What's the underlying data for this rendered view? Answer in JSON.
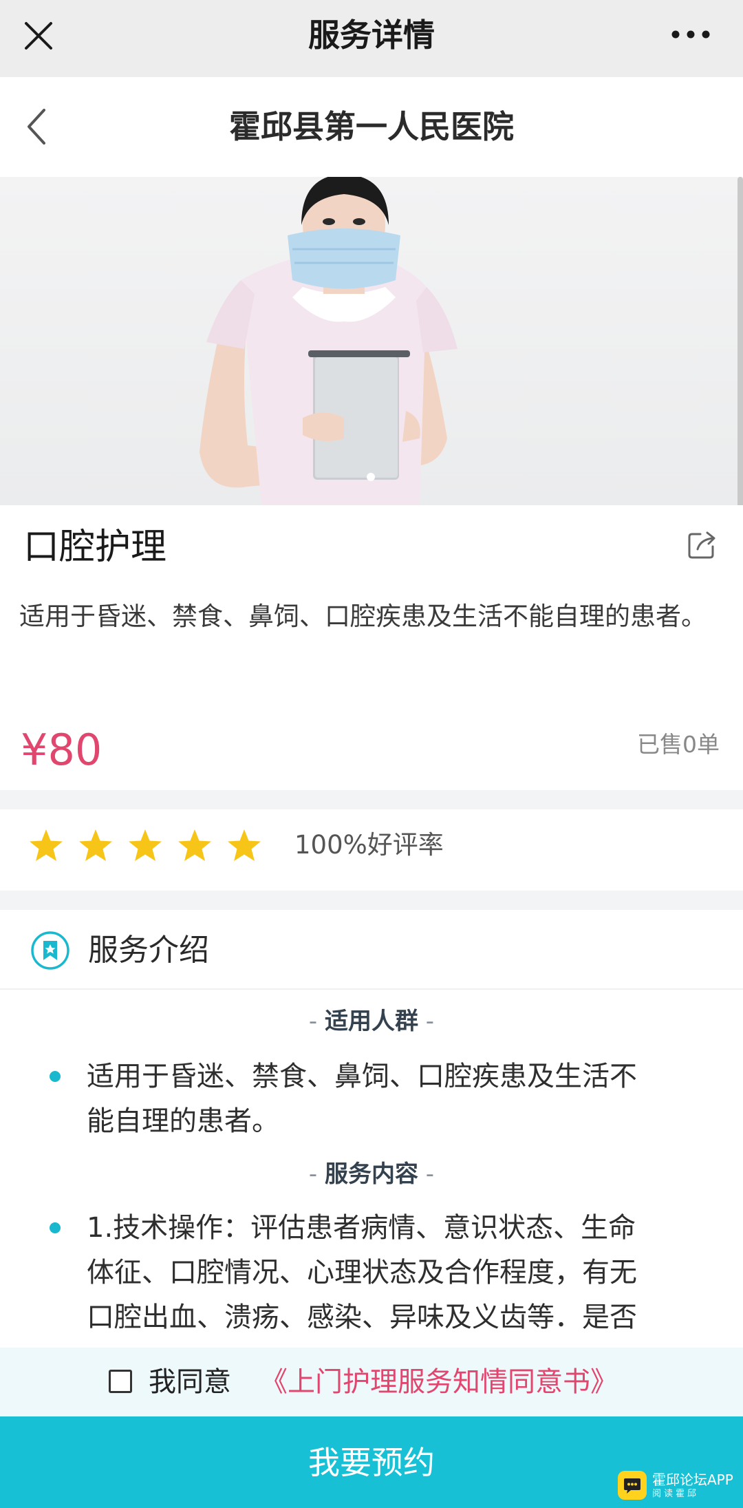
{
  "topbar": {
    "title": "服务详情",
    "close_icon": "close-icon",
    "more_icon": "more-dots-icon"
  },
  "navbar": {
    "title": "霍邱县第一人民医院",
    "back_icon": "chevron-left-icon"
  },
  "hero": {
    "image": "nurse-with-mask-holding-clipboard-photo"
  },
  "service": {
    "title": "口腔护理",
    "description": "适用于昏迷、禁食、鼻饲、口腔疾患及生活不能自理的患者。",
    "price": "¥80",
    "sold": "已售0单"
  },
  "rating": {
    "stars": 5,
    "max_stars": 5,
    "rate_text": "100%好评率",
    "star_color": "#f7c518"
  },
  "intro": {
    "title": "服务介绍",
    "sections": [
      {
        "heading": "适用人群",
        "lines": [
          "适用于昏迷、禁食、鼻饲、口腔疾患及生活不",
          "能自理的患者。"
        ]
      },
      {
        "heading": "服务内容",
        "lines": [
          "1.技术操作：评估患者病情、意识状态、生命",
          "体征、口腔情况、心理状态及合作程度，有无",
          "口腔出血、溃疡、感染、异味及义齿等．是否"
        ]
      }
    ]
  },
  "agreement": {
    "prefix": "我同意",
    "link": "《上门护理服务知情同意书》",
    "checked": false
  },
  "cta": {
    "label": "我要预约"
  },
  "watermark": {
    "title": "霍邱论坛APP",
    "subtitle": "阅读霍邱"
  },
  "colors": {
    "accent": "#17c0d4",
    "price": "#e0466e",
    "topbar": "#ededed",
    "section_gap": "#f3f4f5"
  }
}
